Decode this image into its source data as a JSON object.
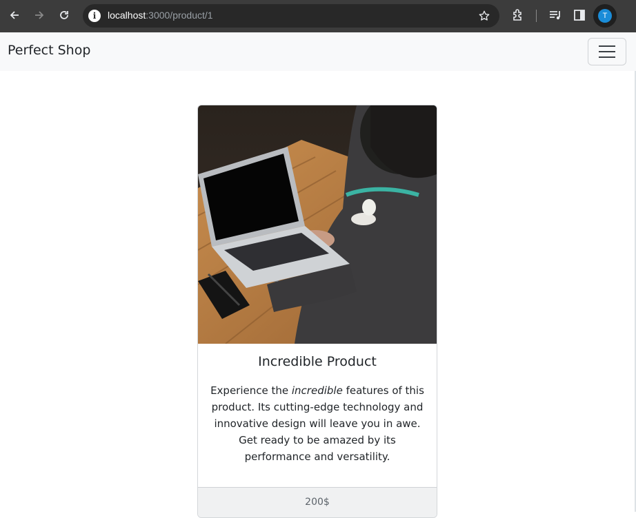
{
  "browser": {
    "url_host": "localhost",
    "url_path": ":3000/product/1",
    "profile_initial": "T",
    "icons": [
      "back-arrow-icon",
      "forward-arrow-icon",
      "reload-icon",
      "site-info-icon",
      "bookmark-star-icon",
      "extensions-icon",
      "media-controls-icon",
      "side-panel-icon",
      "profile-avatar"
    ]
  },
  "navbar": {
    "brand": "Perfect Shop",
    "toggler_icon": "hamburger-menu-icon"
  },
  "product": {
    "image_alt": "Person typing on a laptop at a wooden table",
    "title": "Incredible Product",
    "description_before": "Experience the ",
    "description_emphasis": "incredible",
    "description_after": " features of this product. Its cutting-edge technology and innovative design will leave you in awe. Get ready to be amazed by its performance and versatility.",
    "price": "200$"
  }
}
